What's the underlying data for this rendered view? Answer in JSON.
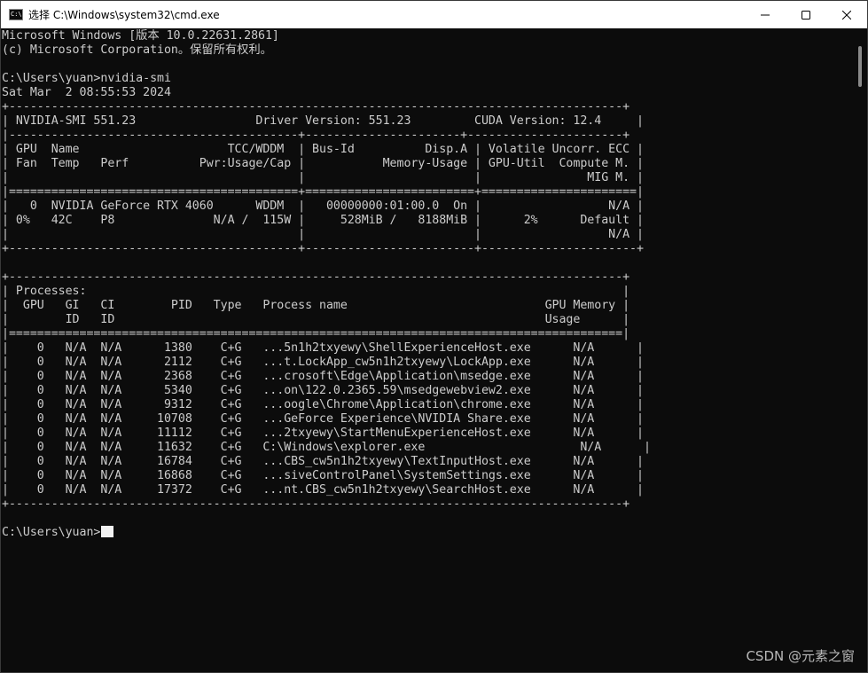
{
  "window": {
    "title": "选择 C:\\Windows\\system32\\cmd.exe",
    "app_icon_glyph": "C:\\",
    "app_icon": "cmd-icon",
    "controls": [
      "minimize-icon",
      "maximize-icon",
      "close-icon"
    ]
  },
  "console": {
    "lines": [
      "Microsoft Windows [版本 10.0.22631.2861]",
      "(c) Microsoft Corporation。保留所有权利。",
      "",
      "C:\\Users\\yuan>nvidia-smi",
      "Sat Mar  2 08:55:53 2024",
      "+---------------------------------------------------------------------------------------+",
      "| NVIDIA-SMI 551.23                 Driver Version: 551.23         CUDA Version: 12.4     |",
      "|-----------------------------------------+----------------------+----------------------+",
      "| GPU  Name                     TCC/WDDM  | Bus-Id          Disp.A | Volatile Uncorr. ECC |",
      "| Fan  Temp   Perf          Pwr:Usage/Cap |           Memory-Usage | GPU-Util  Compute M. |",
      "|                                         |                        |               MIG M. |",
      "|=========================================+========================+======================|",
      "|   0  NVIDIA GeForce RTX 4060      WDDM  |   00000000:01:00.0  On |                  N/A |",
      "| 0%   42C    P8              N/A /  115W |     528MiB /   8188MiB |      2%      Default |",
      "|                                         |                        |                  N/A |",
      "+-----------------------------------------+------------------------+----------------------+",
      "",
      "+---------------------------------------------------------------------------------------+",
      "| Processes:                                                                            |",
      "|  GPU   GI   CI        PID   Type   Process name                            GPU Memory |",
      "|        ID   ID                                                             Usage      |",
      "|=======================================================================================|",
      "|    0   N/A  N/A      1380    C+G   ...5n1h2txyewy\\ShellExperienceHost.exe      N/A      |",
      "|    0   N/A  N/A      2112    C+G   ...t.LockApp_cw5n1h2txyewy\\LockApp.exe      N/A      |",
      "|    0   N/A  N/A      2368    C+G   ...crosoft\\Edge\\Application\\msedge.exe      N/A      |",
      "|    0   N/A  N/A      5340    C+G   ...on\\122.0.2365.59\\msedgewebview2.exe      N/A      |",
      "|    0   N/A  N/A      9312    C+G   ...oogle\\Chrome\\Application\\chrome.exe      N/A      |",
      "|    0   N/A  N/A     10708    C+G   ...GeForce Experience\\NVIDIA Share.exe      N/A      |",
      "|    0   N/A  N/A     11112    C+G   ...2txyewy\\StartMenuExperienceHost.exe      N/A      |",
      "|    0   N/A  N/A     11632    C+G   C:\\Windows\\explorer.exe                      N/A      |",
      "|    0   N/A  N/A     16784    C+G   ...CBS_cw5n1h2txyewy\\TextInputHost.exe      N/A      |",
      "|    0   N/A  N/A     16868    C+G   ...siveControlPanel\\SystemSettings.exe      N/A      |",
      "|    0   N/A  N/A     17372    C+G   ...nt.CBS_cw5n1h2txyewy\\SearchHost.exe      N/A      |",
      "+---------------------------------------------------------------------------------------+",
      "",
      "C:\\Users\\yuan>"
    ],
    "prompt_line_index": 35
  },
  "watermark": "CSDN @元素之窗",
  "colors": {
    "background": "#0c0c0c",
    "text": "#cccccc",
    "titlebar": "#ffffff",
    "cursor": "#f2f2f2"
  }
}
